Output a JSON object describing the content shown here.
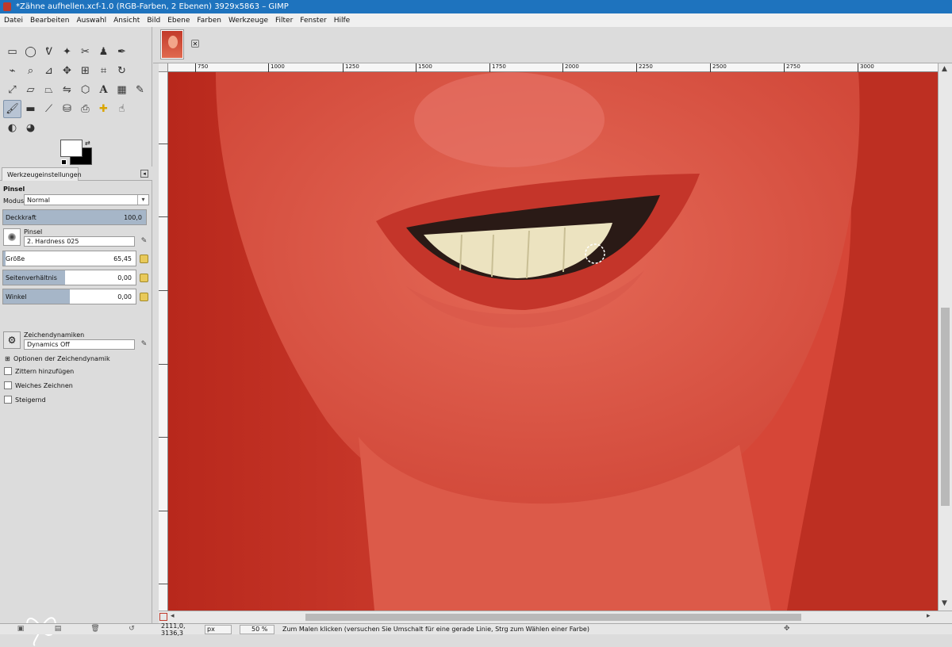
{
  "window": {
    "title": "*Zähne aufhellen.xcf-1.0 (RGB-Farben, 2 Ebenen) 3929x5863 – GIMP"
  },
  "menu": [
    "Datei",
    "Bearbeiten",
    "Auswahl",
    "Ansicht",
    "Bild",
    "Ebene",
    "Farben",
    "Werkzeuge",
    "Filter",
    "Fenster",
    "Hilfe"
  ],
  "toolbox": {
    "rows": [
      [
        "rect-select-icon",
        "ellipse-select-icon",
        "free-select-icon",
        "fuzzy-select-icon",
        "scissors-icon",
        "foreground-select-icon",
        "paths-icon"
      ],
      [
        "color-picker-icon",
        "zoom-icon",
        "measure-icon",
        "move-icon",
        "align-icon",
        "crop-icon",
        "rotate-icon"
      ],
      [
        "scale-icon",
        "shear-icon",
        "perspective-icon",
        "flip-icon",
        "cage-icon",
        "text-icon",
        "blend-icon",
        "pencil-icon"
      ],
      [
        "paintbrush-icon",
        "eraser-icon",
        "airbrush-icon",
        "ink-icon",
        "clone-icon",
        "heal-icon",
        "smudge-icon"
      ],
      [
        "dodge-burn-icon",
        "bucket-fill-icon"
      ]
    ]
  },
  "tool_options": {
    "tab_label": "Werkzeugeinstellungen",
    "tool_name": "Pinsel",
    "mode_label": "Modus:",
    "mode_value": "Normal",
    "opacity": {
      "label": "Deckkraft",
      "value": "100,0",
      "fraction": 1.0
    },
    "brush": {
      "label": "Pinsel",
      "value": "2. Hardness 025"
    },
    "size": {
      "label": "Größe",
      "value": "65,45",
      "fraction": 0.02
    },
    "aspect": {
      "label": "Seitenverhältnis",
      "value": "0,00",
      "fraction": 0.47
    },
    "angle": {
      "label": "Winkel",
      "value": "0,00",
      "fraction": 0.5
    },
    "dynamics": {
      "label": "Zeichendynamiken",
      "value": "Dynamics Off"
    },
    "dynamics_options": "Optionen der Zeichendynamik",
    "jitter": "Zittern hinzufügen",
    "smooth": "Weiches Zeichnen",
    "incremental": "Steigernd"
  },
  "ruler": {
    "ticks": [
      "750",
      "1000",
      "1250",
      "1500",
      "1750",
      "2000",
      "2250",
      "2500",
      "2750",
      "3000"
    ]
  },
  "status": {
    "coords": "2111,0, 3136,3",
    "unit": "px",
    "zoom": "50 %",
    "message": "Zum Malen klicken (versuchen Sie Umschalt für eine gerade Linie, Strg zum Wählen einer Farbe)"
  },
  "colors": {
    "canvas_red": "#d84a3c",
    "titlebar": "#1e73be"
  }
}
